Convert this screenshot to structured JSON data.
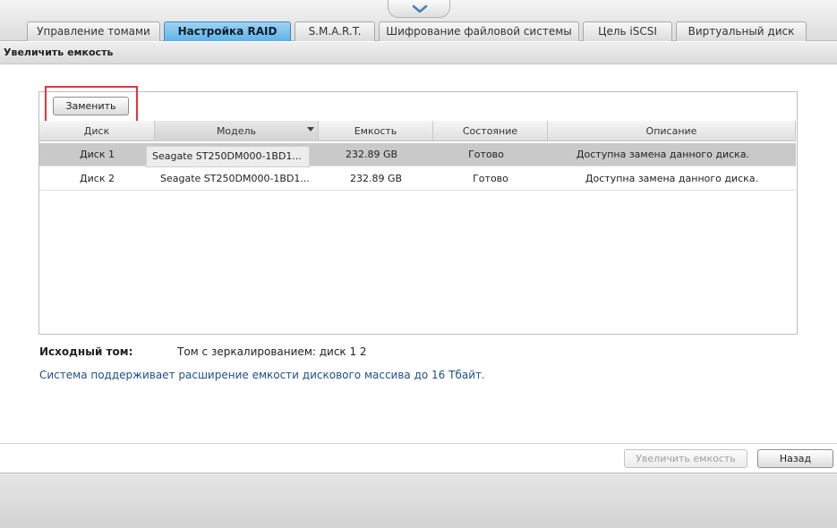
{
  "tabs": [
    {
      "label": "Управление томами",
      "active": false
    },
    {
      "label": "Настройка RAID",
      "active": true
    },
    {
      "label": "S.M.A.R.T.",
      "active": false
    },
    {
      "label": "Шифрование файловой системы",
      "active": false
    },
    {
      "label": "Цель iSCSI",
      "active": false
    },
    {
      "label": "Виртуальный диск",
      "active": false
    }
  ],
  "section": {
    "title": "Увеличить емкость"
  },
  "toolbar": {
    "replace_label": "Заменить"
  },
  "grid": {
    "columns": [
      "Диск",
      "Модель",
      "Емкость",
      "Состояние",
      "Описание"
    ],
    "sorted_column": "Модель",
    "rows": [
      {
        "disk": "Диск 1",
        "model": "Seagate ST250DM000-1BD1...",
        "capacity": "232.89 GB",
        "state": "Готово",
        "description": "Доступна замена данного диска.",
        "selected": true
      },
      {
        "disk": "Диск 2",
        "model": "Seagate ST250DM000-1BD1...",
        "capacity": "232.89 GB",
        "state": "Готово",
        "description": "Доступна замена данного диска.",
        "selected": false
      }
    ]
  },
  "info": {
    "source_label": "Исходный том:",
    "source_value": "Том с зеркалированием: диск 1 2",
    "support_note": "Система поддерживает расширение емкости дискового массива до 16 Тбайт."
  },
  "footer": {
    "expand_label": "Увеличить емкость",
    "expand_disabled": true,
    "back_label": "Назад"
  },
  "colors": {
    "active_tab": "#5fb2e6",
    "highlight_box": "#e0353a",
    "note_text": "#1f4f8a",
    "selected_row": "#c9c9c9"
  }
}
